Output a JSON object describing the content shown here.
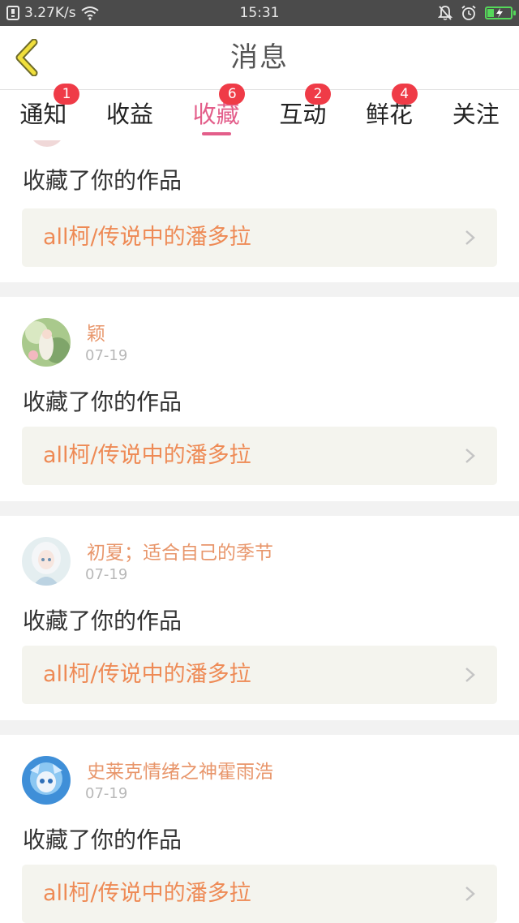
{
  "status_bar": {
    "speed": "3.27K/s",
    "time": "15:31",
    "battery_level": 0.3
  },
  "header": {
    "title": "消息",
    "back_icon": "chevron-left-icon"
  },
  "tabs": [
    {
      "label": "通知",
      "badge": "1",
      "active": false
    },
    {
      "label": "收益",
      "badge": "",
      "active": false
    },
    {
      "label": "收藏",
      "badge": "6",
      "active": true
    },
    {
      "label": "互动",
      "badge": "2",
      "active": false
    },
    {
      "label": "鲜花",
      "badge": "4",
      "active": false
    },
    {
      "label": "关注",
      "badge": "",
      "active": false
    }
  ],
  "colors": {
    "accent": "#e35e8a",
    "badge": "#ef3b47",
    "username": "#e8966b",
    "work_title": "#ee8a55"
  },
  "first_card": {
    "action": "收藏了你的作品",
    "work_title": "all柯/传说中的潘多拉"
  },
  "notifications": [
    {
      "user": "颖",
      "date": "07-19",
      "action": "收藏了你的作品",
      "work_title": "all柯/传说中的潘多拉"
    },
    {
      "user": "初夏；适合自己的季节",
      "date": "07-19",
      "action": "收藏了你的作品",
      "work_title": "all柯/传说中的潘多拉"
    },
    {
      "user": "史莱克情绪之神霍雨浩",
      "date": "07-19",
      "action": "收藏了你的作品",
      "work_title": "all柯/传说中的潘多拉"
    }
  ]
}
